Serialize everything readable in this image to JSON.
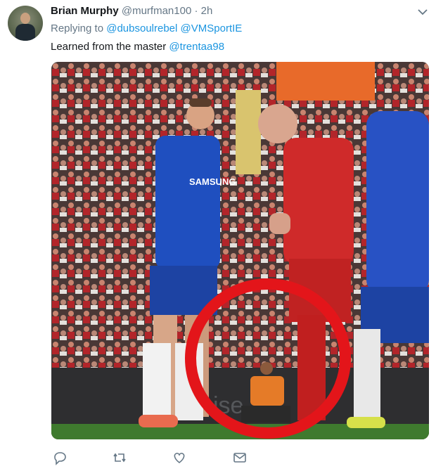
{
  "tweet": {
    "author_name": "Brian Murphy",
    "author_handle": "@murfman100",
    "separator": "·",
    "time": "2h",
    "replying_to_label": "Replying to",
    "replying_to": [
      "@dubsoulrebel",
      "@VMSportIE"
    ],
    "text_plain": "Learned from the master",
    "text_mention": "@trentaa98"
  },
  "media": {
    "description_icons": [
      "photo"
    ],
    "overlay_shirt_text": "SAMSUNG",
    "board_text": "ise",
    "circle_color": "#e3151a"
  },
  "actions": {
    "icons": [
      "reply-icon",
      "retweet-icon",
      "like-icon",
      "dm-icon"
    ]
  },
  "colors": {
    "link": "#1b95e0",
    "muted": "#657786",
    "text": "#14171a"
  }
}
